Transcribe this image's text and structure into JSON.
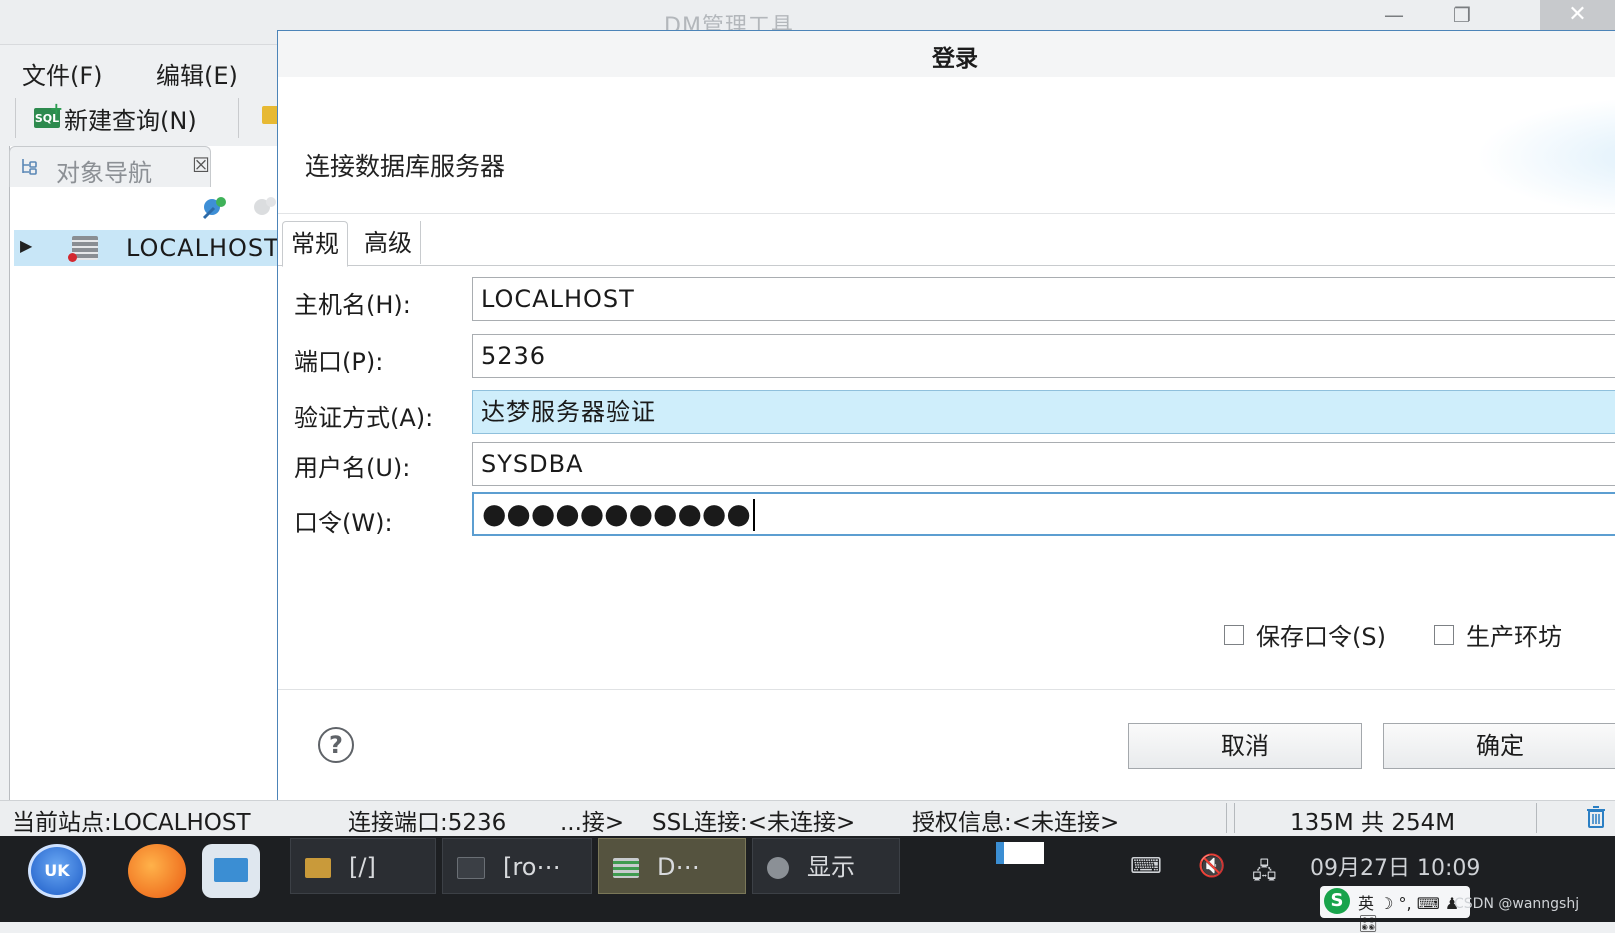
{
  "main_window": {
    "title": "DM管理工具",
    "controls": {
      "minimize": "—",
      "restore": "❐",
      "close": "✕"
    }
  },
  "menubar": [
    "文件(F)",
    "编辑(E)"
  ],
  "toolbar": {
    "new_query": "新建查询(N)",
    "sql_badge": "SQL"
  },
  "object_nav": {
    "tab_label": "对象导航",
    "tab_close": "☒",
    "tree": [
      {
        "label": "LOCALHOST",
        "expander": "▶"
      }
    ]
  },
  "dialog": {
    "title": "登录",
    "heading": "连接数据库服务器",
    "tabs": [
      "常规",
      "高级"
    ],
    "fields": {
      "host": {
        "label": "主机名(H):",
        "value": "LOCALHOST"
      },
      "port": {
        "label": "端口(P):",
        "value": "5236"
      },
      "auth": {
        "label": "验证方式(A):",
        "value": "达梦服务器验证"
      },
      "user": {
        "label": "用户名(U):",
        "value": "SYSDBA"
      },
      "password": {
        "label": "口令(W):",
        "value": "●●●●●●●●●●●"
      }
    },
    "checkboxes": {
      "save_password": "保存口令(S)",
      "production": "生产环坊"
    },
    "help_icon": "?",
    "buttons": {
      "cancel": "取消",
      "ok": "确定"
    }
  },
  "statusbar": {
    "site": "当前站点:LOCALHOST",
    "port": "连接端口:5236",
    "conn": "...接>",
    "ssl": "SSL连接:<未连接>",
    "license": "授权信息:<未连接>",
    "memory": "135M 共 254M"
  },
  "taskbar": {
    "launcher_uk": "UK",
    "tasks": [
      {
        "label": "[/]"
      },
      {
        "label": "[ro⋯"
      },
      {
        "label": "D⋯"
      },
      {
        "label": "显示"
      }
    ],
    "clock": "09月27日 10:09",
    "ime_logo": "S",
    "ime": "英 ☽ °, ⌨ ♟ 🎛",
    "watermark": "CSDN @wanngshj"
  }
}
